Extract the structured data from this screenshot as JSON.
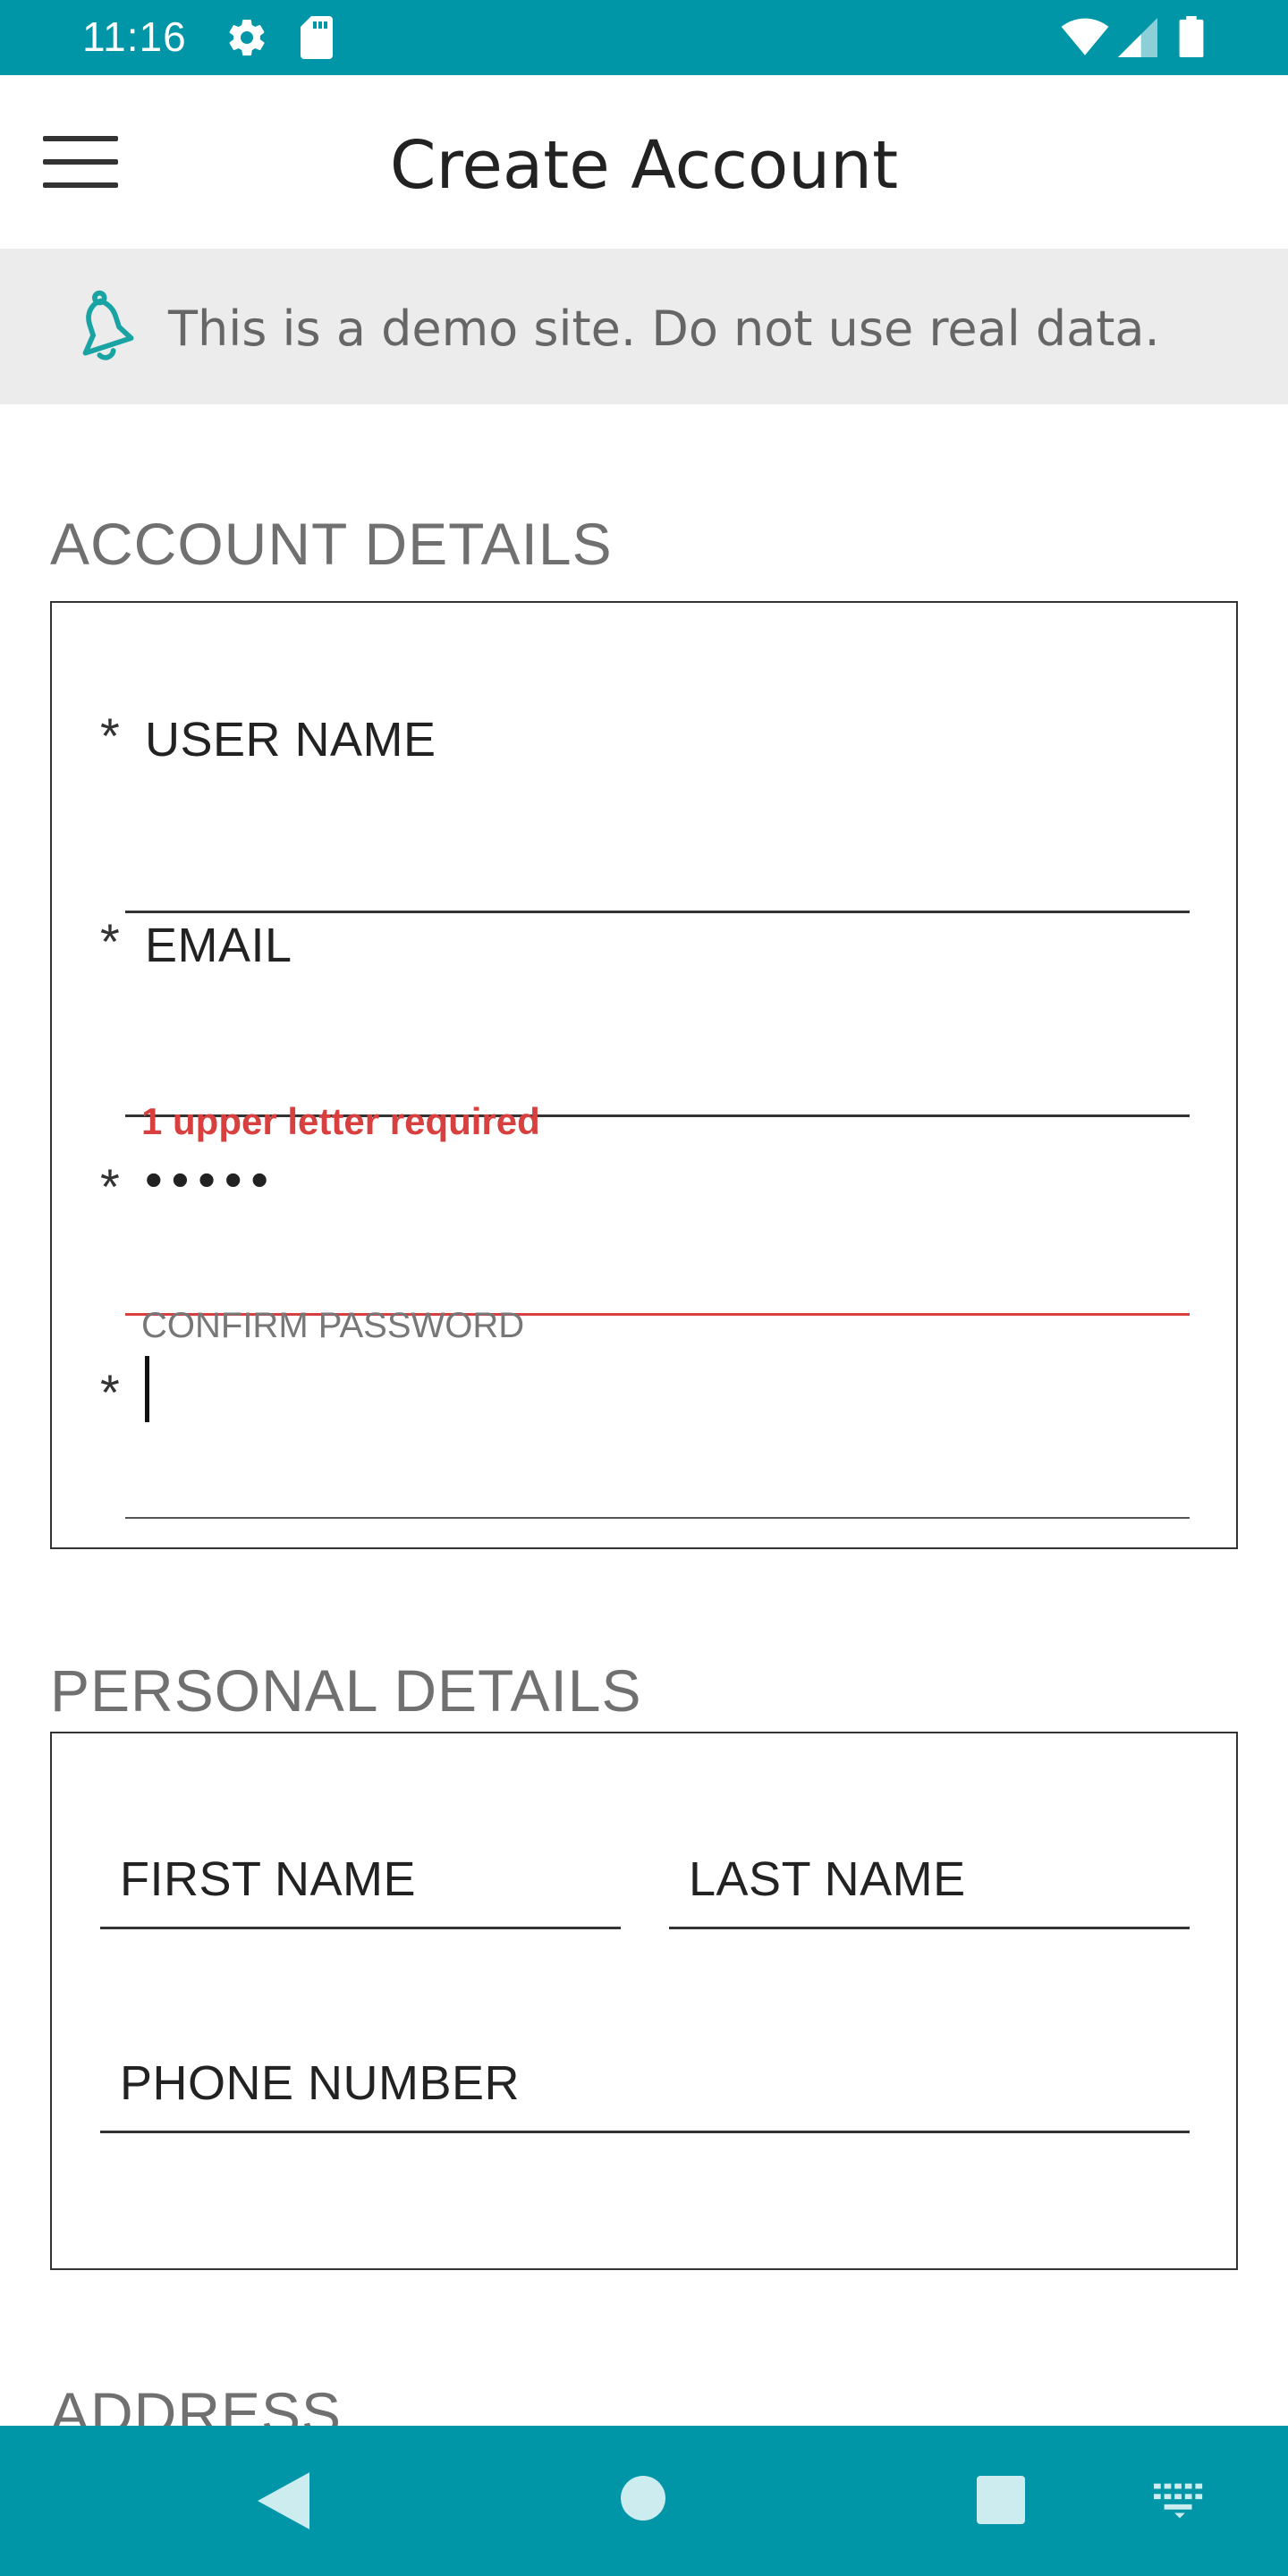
{
  "status_bar": {
    "time": "11:16",
    "icons": [
      "gear-icon",
      "sd-card-icon",
      "wifi-icon",
      "signal-icon",
      "battery-icon"
    ]
  },
  "app_bar": {
    "title": "Create Account",
    "menu_icon": "hamburger-menu-icon"
  },
  "banner": {
    "icon": "bell-icon",
    "text": "This is a demo site. Do not use real data."
  },
  "account_details": {
    "title": "ACCOUNT DETAILS",
    "fields": {
      "user_name": {
        "required_mark": "*",
        "label": "USER NAME"
      },
      "email": {
        "required_mark": "*",
        "label": "EMAIL"
      },
      "password": {
        "required_mark": "*",
        "error": "1 upper letter required",
        "value": "•••••"
      },
      "confirm_password": {
        "required_mark": "*",
        "label": "CONFIRM PASSWORD"
      }
    }
  },
  "personal_details": {
    "title": "PERSONAL DETAILS",
    "fields": {
      "first_name": {
        "label": "FIRST NAME"
      },
      "last_name": {
        "label": "LAST NAME"
      },
      "phone_number": {
        "label": "PHONE NUMBER"
      }
    }
  },
  "address": {
    "title": "ADDRESS"
  },
  "nav_bar": {
    "icons": [
      "back-icon",
      "home-icon",
      "recents-icon",
      "keyboard-icon"
    ]
  },
  "colors": {
    "accent": "#0096a7",
    "error": "#d84040",
    "banner_bg": "#ececec",
    "section_title": "#707070"
  }
}
